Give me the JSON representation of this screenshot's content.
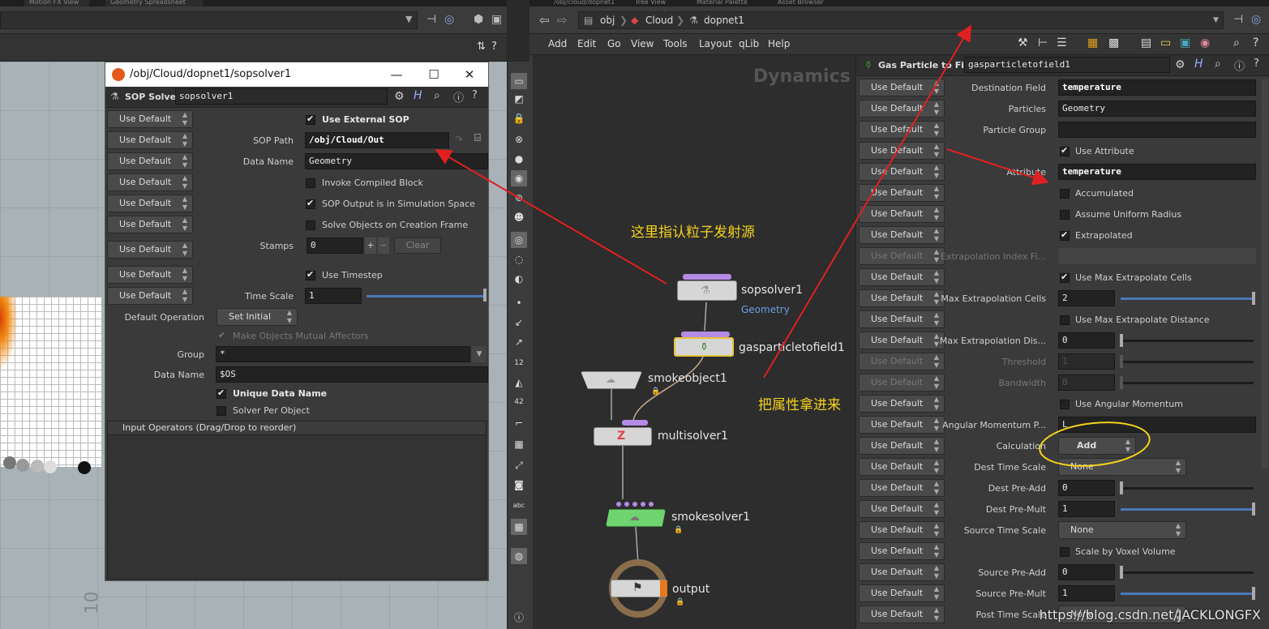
{
  "left_tabs": [
    "Motion FX View",
    "Geometry Spreadsheet"
  ],
  "mid_tabs": [
    "/obj/cloud/dopnet1",
    "Tree View",
    "Material Palette",
    "Asset Browser"
  ],
  "left_viewport": {
    "axis_number": "10"
  },
  "float_window": {
    "title": "/obj/Cloud/dopnet1/sopsolver1",
    "node_type": "SOP Solver",
    "node_name": "sopsolver1",
    "use_default": "Use Default",
    "params": {
      "use_external_sop": "Use External SOP",
      "sop_path_label": "SOP Path",
      "sop_path": "/obj/Cloud/Out",
      "data_name_label": "Data Name",
      "data_name": "Geometry",
      "invoke_compiled": "Invoke Compiled Block",
      "sop_output_sim": "SOP Output is in Simulation Space",
      "solve_creation": "Solve Objects on Creation Frame",
      "stamps_label": "Stamps",
      "stamps": "0",
      "clear": "Clear",
      "use_timestep": "Use Timestep",
      "time_scale_label": "Time Scale",
      "time_scale": "1",
      "default_op_label": "Default Operation",
      "default_op": "Set Initial",
      "mutual_affectors": "Make Objects Mutual Affectors",
      "group_label": "Group",
      "group": "*",
      "data_name2_label": "Data Name",
      "data_name2": "$OS",
      "unique_data_name": "Unique Data Name",
      "solver_per_object": "Solver Per Object",
      "input_ops": "Input Operators (Drag/Drop to reorder)"
    }
  },
  "network": {
    "crumbs": [
      "obj",
      "Cloud",
      "dopnet1"
    ],
    "menus": [
      "Add",
      "Edit",
      "Go",
      "View",
      "Tools",
      "Layout",
      "qLib",
      "Help"
    ],
    "context_title": "Dynamics",
    "nodes": [
      {
        "name": "sopsolver1",
        "sub": "Geometry"
      },
      {
        "name": "gasparticletofield1"
      },
      {
        "name": "smokeobject1"
      },
      {
        "name": "multisolver1"
      },
      {
        "name": "smokesolver1"
      },
      {
        "name": "output"
      }
    ]
  },
  "annotations": {
    "a1": "这里指认粒子发射源",
    "a2": "把属性拿进来"
  },
  "params_panel": {
    "node_type": "Gas Particle to Field",
    "node_name": "gasparticletofield1",
    "rows": [
      {
        "label": "Destination Field",
        "value": "temperature"
      },
      {
        "label": "Particles",
        "value": "Geometry"
      },
      {
        "label": "Particle Group",
        "value": ""
      },
      {
        "check": "Use Attribute"
      },
      {
        "label": "Attribute",
        "value": "temperature"
      },
      {
        "check": "Accumulated"
      },
      {
        "check": "Assume Uniform Radius"
      },
      {
        "check": "Extrapolated"
      },
      {
        "label": "Extrapolation Index Fi..."
      },
      {
        "check": "Use Max Extrapolate Cells"
      },
      {
        "label": "Max Extrapolation Cells",
        "value": "2"
      },
      {
        "check": "Use Max Extrapolate Distance"
      },
      {
        "label": "Max Extrapolation Dis...",
        "value": "0"
      },
      {
        "label": "Threshold",
        "value": "1"
      },
      {
        "label": "Bandwidth",
        "value": "0"
      },
      {
        "check": "Use Angular Momentum"
      },
      {
        "label": "Angular Momentum P...",
        "value": "L"
      },
      {
        "label": "Calculation",
        "value": "Add"
      },
      {
        "label": "Dest Time Scale",
        "value": "None"
      },
      {
        "label": "Dest Pre-Add",
        "value": "0"
      },
      {
        "label": "Dest Pre-Mult",
        "value": "1"
      },
      {
        "label": "Source Time Scale",
        "value": "None"
      },
      {
        "check": "Scale by Voxel Volume"
      },
      {
        "label": "Source Pre-Add",
        "value": "0"
      },
      {
        "label": "Source Pre-Mult",
        "value": "1"
      },
      {
        "label": "Post Time Scale",
        "value": "None"
      }
    ]
  },
  "watermark": "https://blog.csdn.net/JACKLONGFX"
}
